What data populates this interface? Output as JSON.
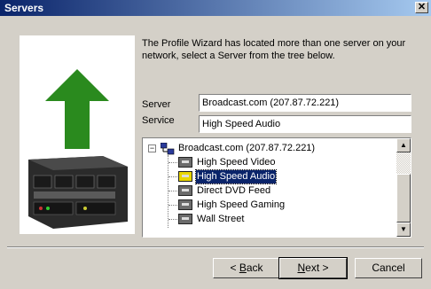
{
  "window": {
    "title": "Servers",
    "close_glyph": "✕"
  },
  "intro_text": "The Profile Wizard has located more than one server on your network, select a Server from the tree below.",
  "form": {
    "server_label": "Server",
    "server_value": "Broadcast.com (207.87.72.221)",
    "service_label": "Service",
    "service_value": "High Speed Audio"
  },
  "tree": {
    "expander": "−",
    "root": "Broadcast.com (207.87.72.221)",
    "items": [
      {
        "label": "High Speed Video",
        "selected": false
      },
      {
        "label": "High Speed Audio",
        "selected": true
      },
      {
        "label": "Direct DVD Feed",
        "selected": false
      },
      {
        "label": "High Speed Gaming",
        "selected": false
      },
      {
        "label": "Wall Street",
        "selected": false
      }
    ]
  },
  "scrollbar": {
    "up_glyph": "▲",
    "down_glyph": "▼"
  },
  "buttons": {
    "back_prefix": "< ",
    "back_mnemonic": "B",
    "back_rest": "ack",
    "next_mnemonic": "N",
    "next_rest": "ext >",
    "cancel": "Cancel"
  },
  "colors": {
    "titlebar": "#0a246a",
    "arrow": "#2a8a1e",
    "selection": "#0a246a"
  },
  "icons": [
    "up-arrow-icon",
    "server-chassis-icon",
    "network-root-icon",
    "service-icon"
  ]
}
